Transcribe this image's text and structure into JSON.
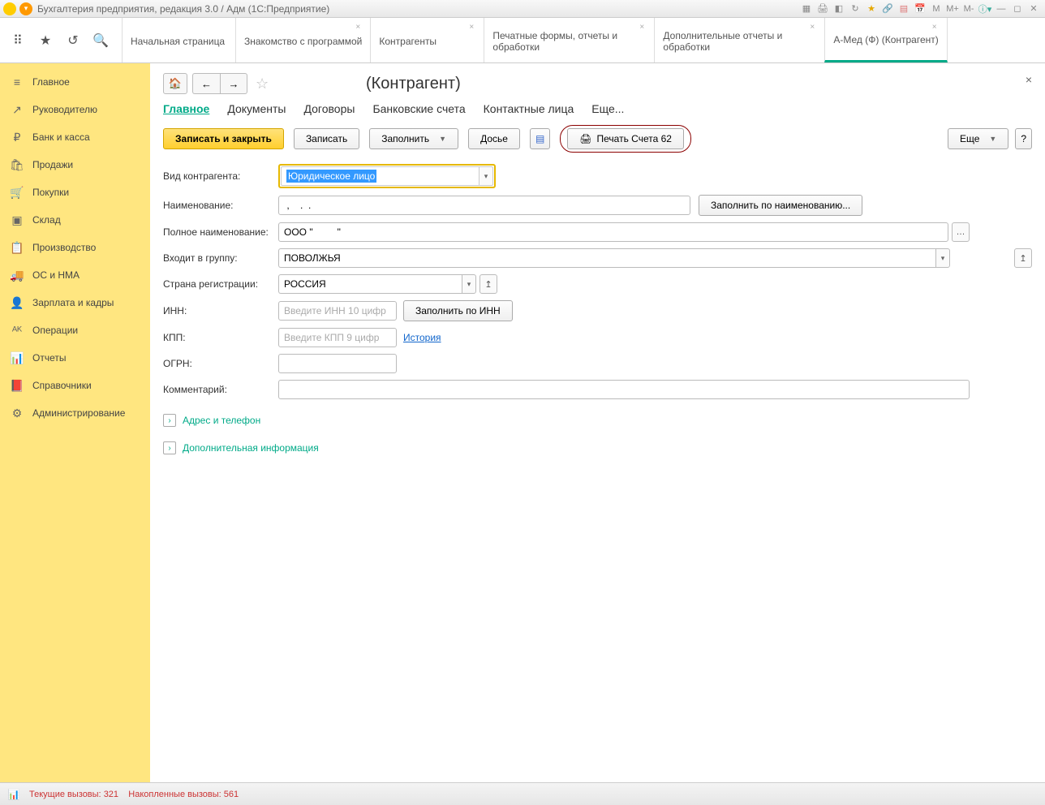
{
  "title": "Бухгалтерия предприятия, редакция 3.0 / Адм   (1С:Предприятие)",
  "titlebar_icons": {
    "m": "M",
    "mplus": "M+",
    "mminus": "M-"
  },
  "tabs": [
    {
      "label": "Начальная страница"
    },
    {
      "label": "Знакомство с программой"
    },
    {
      "label": "Контрагенты"
    },
    {
      "label": "Печатные формы, отчеты и обработки"
    },
    {
      "label": "Дополнительные отчеты и обработки"
    },
    {
      "label": "А-Мед (Ф) (Контрагент)"
    }
  ],
  "sidebar": [
    {
      "label": "Главное",
      "icon": "≡"
    },
    {
      "label": "Руководителю",
      "icon": "↗"
    },
    {
      "label": "Банк и касса",
      "icon": "₽"
    },
    {
      "label": "Продажи",
      "icon": "🛍"
    },
    {
      "label": "Покупки",
      "icon": "🛒"
    },
    {
      "label": "Склад",
      "icon": "▣"
    },
    {
      "label": "Производство",
      "icon": "📋"
    },
    {
      "label": "ОС и НМА",
      "icon": "🚚"
    },
    {
      "label": "Зарплата и кадры",
      "icon": "👤"
    },
    {
      "label": "Операции",
      "icon": "ᴬᴷ"
    },
    {
      "label": "Отчеты",
      "icon": "📊"
    },
    {
      "label": "Справочники",
      "icon": "📕"
    },
    {
      "label": "Администрирование",
      "icon": "⚙"
    }
  ],
  "page": {
    "title": "(Контрагент)",
    "subnav": [
      "Главное",
      "Документы",
      "Договоры",
      "Банковские счета",
      "Контактные лица",
      "Еще..."
    ]
  },
  "toolbar": {
    "save_close": "Записать и закрыть",
    "save": "Записать",
    "fill": "Заполнить",
    "dossier": "Досье",
    "print": "Печать Счета 62",
    "more": "Еще",
    "help": "?"
  },
  "form": {
    "labels": {
      "kind": "Вид контрагента:",
      "name": "Наименование:",
      "fullname": "Полное наименование:",
      "group": "Входит в группу:",
      "country": "Страна регистрации:",
      "inn": "ИНН:",
      "kpp": "КПП:",
      "ogrn": "ОГРН:",
      "comment": "Комментарий:"
    },
    "values": {
      "kind": "Юридическое лицо",
      "name": " ,    .  .",
      "fullname": "ООО \"         \"",
      "group": "ПОВОЛЖЬЯ",
      "country": "РОССИЯ",
      "inn": "",
      "kpp": "",
      "ogrn": "",
      "comment": ""
    },
    "placeholders": {
      "inn": "Введите ИНН 10 цифр",
      "kpp": "Введите КПП 9 цифр"
    },
    "buttons": {
      "fill_by_name": "Заполнить по наименованию...",
      "fill_by_inn": "Заполнить по ИНН"
    },
    "links": {
      "history": "История"
    },
    "expanders": {
      "address": "Адрес и телефон",
      "extra": "Дополнительная информация"
    }
  },
  "status": {
    "curr_label": "Текущие вызовы:",
    "curr_val": "321",
    "acc_label": "Накопленные вызовы:",
    "acc_val": "561"
  }
}
